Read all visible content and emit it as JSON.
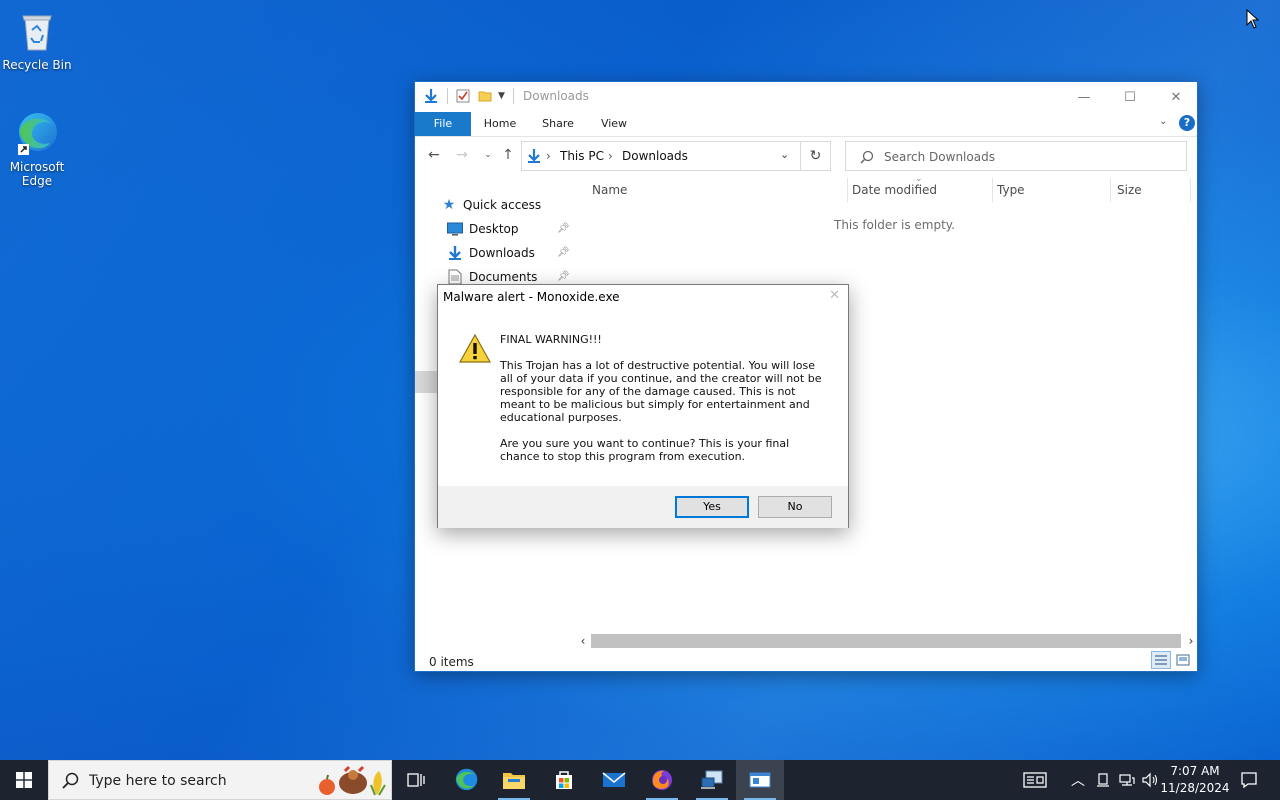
{
  "desktop": {
    "icons": [
      {
        "label": "Recycle Bin",
        "icon": "recycle-bin-icon"
      },
      {
        "label": "Microsoft Edge",
        "icon": "edge-icon"
      }
    ]
  },
  "explorer": {
    "title": "Downloads",
    "window_controls": {
      "minimize": "—",
      "maximize": "☐",
      "close": "✕"
    },
    "ribbon_tabs": [
      "File",
      "Home",
      "Share",
      "View"
    ],
    "address": {
      "root": "This PC",
      "current": "Downloads"
    },
    "search": {
      "placeholder": "Search Downloads"
    },
    "columns": [
      "Name",
      "Date modified",
      "Type",
      "Size"
    ],
    "nav_pane": {
      "quick_access": "Quick access",
      "items": [
        {
          "label": "Desktop",
          "icon": "desktop-icon",
          "pinned": true
        },
        {
          "label": "Downloads",
          "icon": "download-arrow-icon",
          "pinned": true
        },
        {
          "label": "Documents",
          "icon": "documents-icon",
          "pinned": true
        }
      ]
    },
    "empty_message": "This folder is empty.",
    "status": "0 items",
    "accent_color": "#1979ca"
  },
  "dialog": {
    "title": "Malware alert - Monoxide.exe",
    "heading": "FINAL WARNING!!!",
    "paragraph1": "This Trojan has a lot of destructive potential. You will lose all of your data if you continue, and the creator will not be responsible for any of the damage caused. This is not meant to be malicious but simply for entertainment and educational purposes.",
    "paragraph2": "Are you sure you want to continue? This is your final chance to stop this program from execution.",
    "yes_label": "Yes",
    "no_label": "No",
    "icon": "warning-icon"
  },
  "taskbar": {
    "search_placeholder": "Type here to search",
    "time": "7:07 AM",
    "date": "11/28/2024",
    "apps": [
      "task-view",
      "edge",
      "file-explorer",
      "microsoft-store",
      "mail",
      "firefox",
      "network-app",
      "active-window"
    ]
  }
}
